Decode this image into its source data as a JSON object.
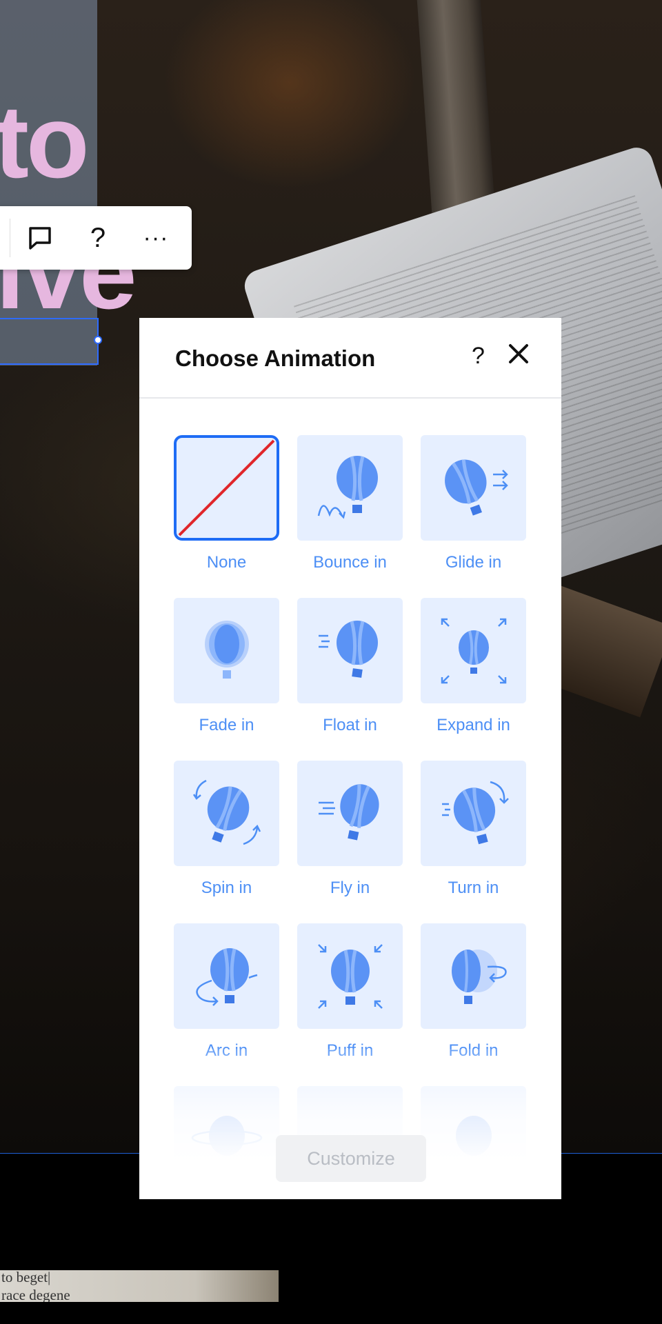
{
  "background": {
    "bottom_text_lines": [
      "to beget|",
      "race degene"
    ]
  },
  "canvas_text": {
    "word_top": "to",
    "word_bottom": "ive"
  },
  "toolbar": {
    "comment_icon": "speech-bubble-icon",
    "help_label": "?",
    "more_label": "···"
  },
  "dialog": {
    "title": "Choose Animation",
    "help_label": "?",
    "close_icon": "close-icon",
    "accent_color": "#4d8ff5",
    "selected_color": "#1e6cf5",
    "animations": [
      {
        "label": "None",
        "icon": "none-slash-icon",
        "selected": true
      },
      {
        "label": "Bounce in",
        "icon": "bounce-balloon-icon"
      },
      {
        "label": "Glide in",
        "icon": "glide-balloon-icon"
      },
      {
        "label": "Fade in",
        "icon": "fade-balloon-icon"
      },
      {
        "label": "Float in",
        "icon": "float-balloon-icon"
      },
      {
        "label": "Expand in",
        "icon": "expand-balloon-icon"
      },
      {
        "label": "Spin in",
        "icon": "spin-balloon-icon"
      },
      {
        "label": "Fly in",
        "icon": "fly-balloon-icon"
      },
      {
        "label": "Turn in",
        "icon": "turn-balloon-icon"
      },
      {
        "label": "Arc in",
        "icon": "arc-balloon-icon"
      },
      {
        "label": "Puff in",
        "icon": "puff-balloon-icon"
      },
      {
        "label": "Fold in",
        "icon": "fold-balloon-icon"
      }
    ],
    "customize_label": "Customize"
  }
}
